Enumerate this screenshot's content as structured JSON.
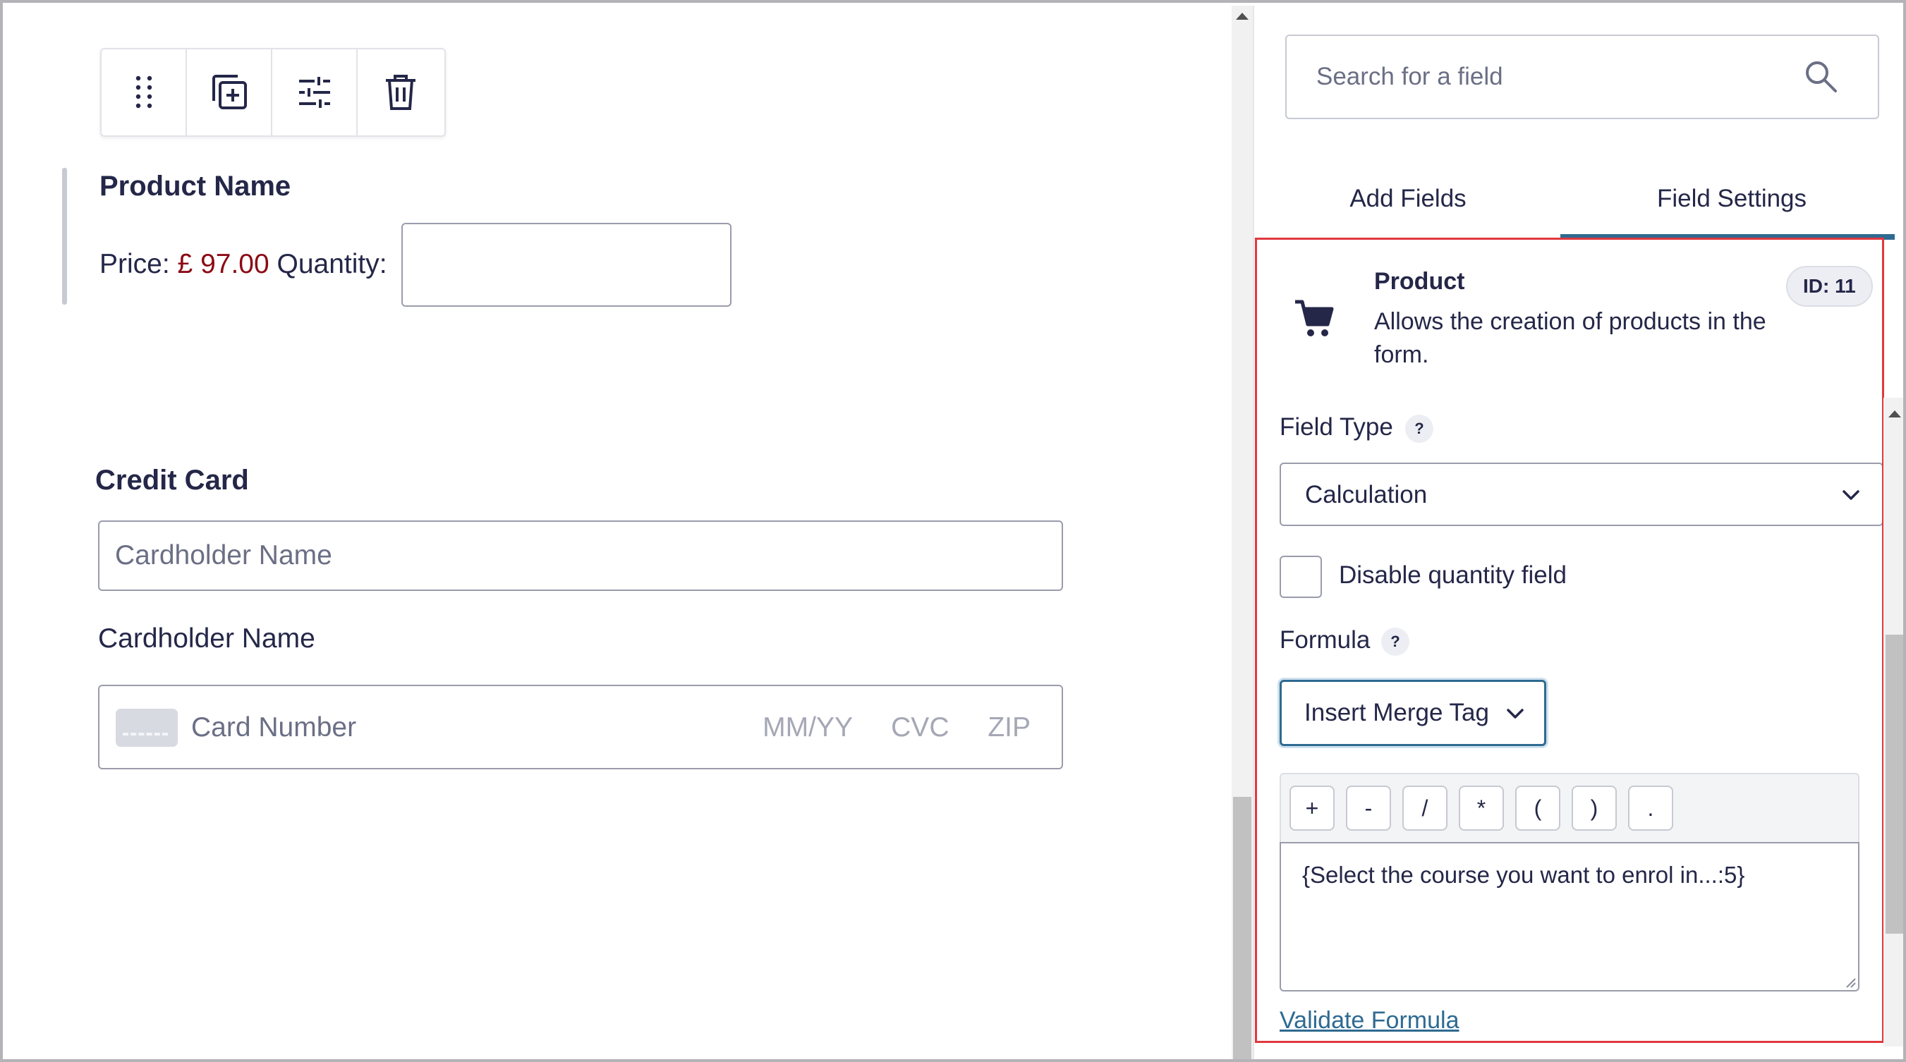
{
  "canvas": {
    "toolbar": {
      "buttons": [
        {
          "name": "drag-handle",
          "icon": "drag-dots-icon"
        },
        {
          "name": "duplicate",
          "icon": "duplicate-icon"
        },
        {
          "name": "settings",
          "icon": "sliders-icon"
        },
        {
          "name": "delete",
          "icon": "trash-icon"
        }
      ]
    },
    "product_field": {
      "label": "Product Name",
      "price_label": "Price:",
      "price_value": "£ 97.00",
      "quantity_label": "Quantity:",
      "quantity_value": ""
    },
    "credit_card_field": {
      "label": "Credit Card",
      "cardholder_placeholder": "Cardholder Name",
      "cardholder_sublabel": "Cardholder Name",
      "card_number_placeholder": "Card Number",
      "expiry_placeholder": "MM/YY",
      "cvc_placeholder": "CVC",
      "zip_placeholder": "ZIP"
    }
  },
  "panel": {
    "search": {
      "placeholder": "Search for a field",
      "value": ""
    },
    "tabs": [
      {
        "label": "Add Fields",
        "active": false
      },
      {
        "label": "Field Settings",
        "active": true
      }
    ],
    "field_info": {
      "icon": "shopping-cart-icon",
      "title": "Product",
      "description": "Allows the creation of products in the form.",
      "id_badge": "ID: 11"
    },
    "field_type": {
      "label": "Field Type",
      "help": "?",
      "value": "Calculation"
    },
    "disable_quantity": {
      "label": "Disable quantity field",
      "checked": false
    },
    "formula": {
      "label": "Formula",
      "help": "?",
      "merge_tag_value": "Insert Merge Tag",
      "operators": [
        "+",
        "-",
        "/",
        "*",
        "(",
        ")",
        "."
      ],
      "value": "{Select the course you want to enrol in...:5}",
      "validate_label": "Validate Formula"
    }
  },
  "colors": {
    "accent": "#2e6a91",
    "price": "#8b0a14",
    "highlight_box": "#e0383e",
    "text": "#242748"
  }
}
